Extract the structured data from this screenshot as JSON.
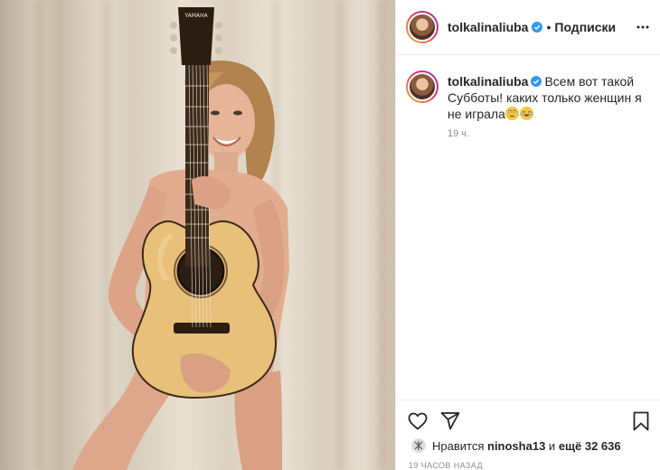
{
  "post": {
    "author": "tolkalinaliuba",
    "verified": true,
    "follow_state": "Подписки",
    "separator": "•",
    "caption": "Всем вот такой Субботы! каких только женщин я не играла",
    "caption_emojis": [
      "eyes-rolling-emoji",
      "laughing-tears-emoji"
    ],
    "relative_time": "19 ч.",
    "likes_prefix": "Нравится",
    "likes_user": "ninosha13",
    "likes_middle": "и",
    "likes_rest": "ещё 32 636",
    "posted_label": "19 ЧАСОВ НАЗАД"
  },
  "photo": {
    "guitar_brand": "YAMAHA",
    "description_icon": "photo-content"
  },
  "icons": {
    "more": "more-options-icon",
    "like": "heart-icon",
    "share": "share-paper-plane-icon",
    "save": "bookmark-icon",
    "verified": "verified-badge-icon"
  },
  "colors": {
    "verified": "#3897f0",
    "text": "#262626",
    "muted": "#8e8e8e",
    "border": "#efefef"
  }
}
